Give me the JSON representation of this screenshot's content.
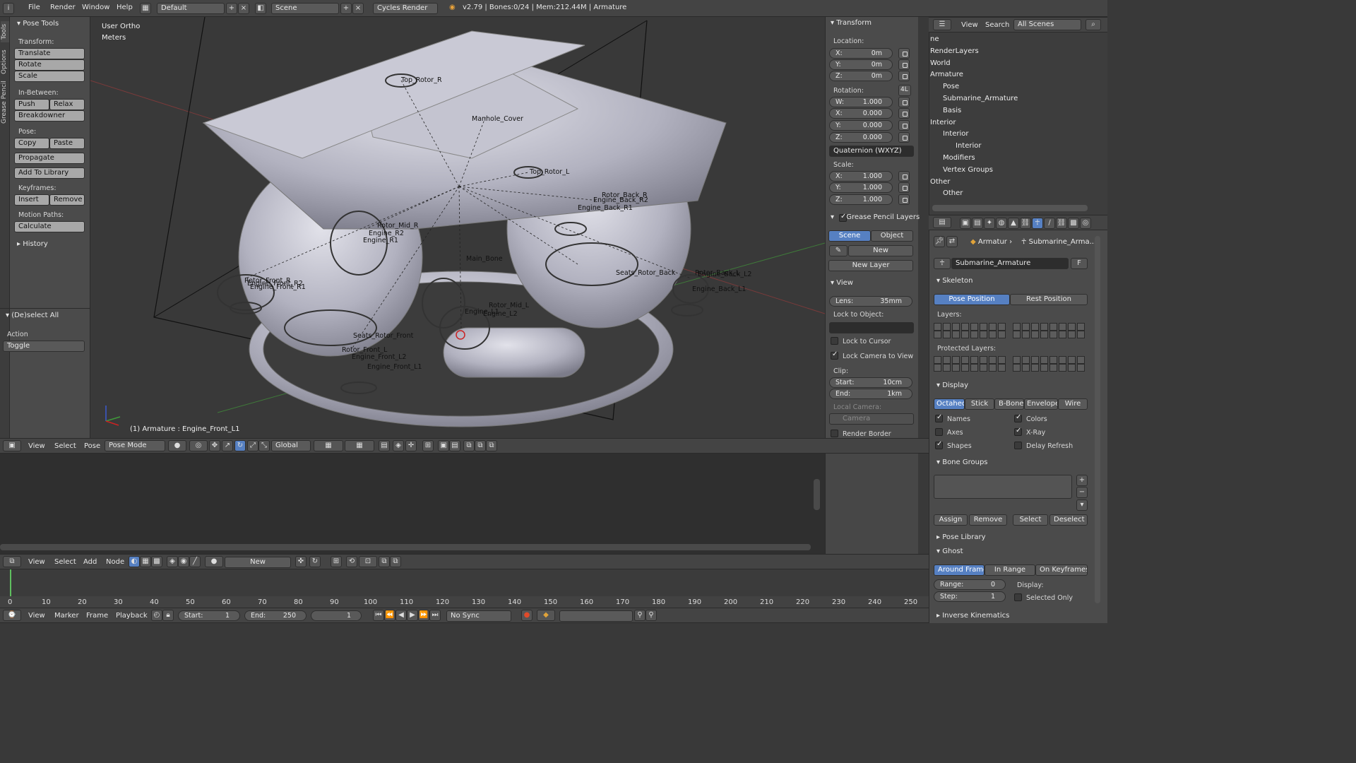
{
  "topbar": {
    "menus": [
      "File",
      "Render",
      "Window",
      "Help"
    ],
    "screen_layout": "Default",
    "scene": "Scene",
    "render_engine": "Cycles Render",
    "stats": "v2.79 | Bones:0/24 | Mem:212.44M | Armature"
  },
  "tool_tabs": [
    "Tools",
    "Options",
    "Grease Pencil"
  ],
  "pose_tools": {
    "title": "Pose Tools",
    "transform_label": "Transform:",
    "translate": "Translate",
    "rotate": "Rotate",
    "scale": "Scale",
    "inbetween_label": "In-Between:",
    "push": "Push",
    "relax": "Relax",
    "breakdowner": "Breakdowner",
    "pose_label": "Pose:",
    "copy": "Copy",
    "paste": "Paste",
    "propagate": "Propagate",
    "add_to_library": "Add To Library",
    "keyframes_label": "Keyframes:",
    "insert": "Insert",
    "remove": "Remove",
    "motion_paths_label": "Motion Paths:",
    "calculate": "Calculate",
    "history": "History"
  },
  "operator": {
    "title": "(De)select All",
    "action_label": "Action",
    "action_value": "Toggle"
  },
  "viewport": {
    "view_name": "User Ortho",
    "units": "Meters",
    "active_info": "(1) Armature : Engine_Front_L1",
    "bone_labels": [
      {
        "id": "top-rotor-r",
        "text": "Top_Rotor_R"
      },
      {
        "id": "manhole-cover",
        "text": "Manhole_Cover"
      },
      {
        "id": "top-rotor-l",
        "text": "Top_Rotor_L"
      },
      {
        "id": "rotor-back-r",
        "text": "Rotor_Back_R"
      },
      {
        "id": "engine-back-r2",
        "text": "Engine_Back_R2"
      },
      {
        "id": "engine-back-r1",
        "text": "Engine_Back_R1"
      },
      {
        "id": "rotor-mid-r",
        "text": "Rotor_Mid_R"
      },
      {
        "id": "engine-r2",
        "text": "Engine_R2"
      },
      {
        "id": "engine-r1",
        "text": "Engine_R1"
      },
      {
        "id": "main-bone",
        "text": "Main_Bone"
      },
      {
        "id": "seats-rotor-back",
        "text": "Seats_Rotor_Back"
      },
      {
        "id": "rotor-back-l",
        "text": "Rotor_Back_L"
      },
      {
        "id": "engine-back-l2",
        "text": "Engine_Back_L2"
      },
      {
        "id": "engine-back-l1",
        "text": "Engine_Back_L1"
      },
      {
        "id": "rotor-front-r",
        "text": "Rotor_Front_R"
      },
      {
        "id": "engine-front-r2",
        "text": "Engine_Front_R2"
      },
      {
        "id": "engine-front-r1",
        "text": "Engine_Front_R1"
      },
      {
        "id": "rotor-mid-l",
        "text": "Rotor_Mid_L"
      },
      {
        "id": "engine-l1",
        "text": "Engine_L1"
      },
      {
        "id": "engine-l2",
        "text": "Engine_L2"
      },
      {
        "id": "seats-rotor-front",
        "text": "Seats_Rotor_Front"
      },
      {
        "id": "rotor-front-l",
        "text": "Rotor_Front_L"
      },
      {
        "id": "engine-front-l2",
        "text": "Engine_Front_L2"
      },
      {
        "id": "engine-front-l1",
        "text": "Engine_Front_L1"
      }
    ]
  },
  "transform_panel": {
    "title": "Transform",
    "location_label": "Location:",
    "loc_x": "X:",
    "loc_x_val": "0m",
    "loc_y": "Y:",
    "loc_y_val": "0m",
    "loc_z": "Z:",
    "loc_z_val": "0m",
    "rotation_label": "Rotation:",
    "rot_4l": "4L",
    "rot_w": "W:",
    "rot_w_val": "1.000",
    "rot_x": "X:",
    "rot_x_val": "0.000",
    "rot_y": "Y:",
    "rot_y_val": "0.000",
    "rot_z": "Z:",
    "rot_z_val": "0.000",
    "rotation_mode": "Quaternion (WXYZ)",
    "scale_label": "Scale:",
    "sc_x": "X:",
    "sc_x_val": "1.000",
    "sc_y": "Y:",
    "sc_y_val": "1.000",
    "sc_z": "Z:",
    "sc_z_val": "1.000"
  },
  "grease_pencil": {
    "title": "Grease Pencil Layers",
    "scene_tab": "Scene",
    "object_tab": "Object",
    "new": "New",
    "new_layer": "New Layer"
  },
  "view_panel": {
    "title": "View",
    "lens_label": "Lens:",
    "lens_val": "35mm",
    "lock_to_object": "Lock to Object:",
    "lock_to_cursor": "Lock to Cursor",
    "lock_camera": "Lock Camera to View",
    "clip_label": "Clip:",
    "start_label": "Start:",
    "start_val": "10cm",
    "end_label": "End:",
    "end_val": "1km",
    "local_camera": "Local Camera:",
    "camera": "Camera",
    "render_border": "Render Border"
  },
  "viewport_header": {
    "view": "View",
    "select": "Select",
    "pose": "Pose",
    "mode": "Pose Mode",
    "orientation": "Global"
  },
  "node_header": {
    "view": "View",
    "select": "Select",
    "add": "Add",
    "node": "Node",
    "new": "New"
  },
  "timeline": {
    "ticks": [
      "0",
      "10",
      "20",
      "30",
      "40",
      "50",
      "60",
      "70",
      "80",
      "90",
      "100",
      "110",
      "120",
      "130",
      "140",
      "150",
      "160",
      "170",
      "180",
      "190",
      "200",
      "210",
      "220",
      "230",
      "240",
      "250"
    ],
    "view": "View",
    "marker": "Marker",
    "frame": "Frame",
    "playback": "Playback",
    "start_label": "Start:",
    "start_val": "1",
    "end_label": "End:",
    "end_val": "250",
    "current": "1",
    "sync": "No Sync"
  },
  "outliner": {
    "view": "View",
    "search": "Search",
    "filter": "All Scenes",
    "items": [
      {
        "text": "ne",
        "indent": 0
      },
      {
        "text": "RenderLayers",
        "indent": 0
      },
      {
        "text": "World",
        "indent": 0
      },
      {
        "text": "Armature",
        "indent": 0
      },
      {
        "text": "Pose",
        "indent": 1
      },
      {
        "text": "Submarine_Armature",
        "indent": 1
      },
      {
        "text": "Basis",
        "indent": 1
      },
      {
        "text": "Interior",
        "indent": 0
      },
      {
        "text": "Interior",
        "indent": 1
      },
      {
        "text": "Interior",
        "indent": 2
      },
      {
        "text": "Modifiers",
        "indent": 1
      },
      {
        "text": "Vertex Groups",
        "indent": 1
      },
      {
        "text": "Other",
        "indent": 0
      },
      {
        "text": "Other",
        "indent": 1
      }
    ]
  },
  "properties": {
    "breadcrumb_1": "Armatur",
    "breadcrumb_2": "Submarine_Arma...",
    "datablock": "Submarine_Armature",
    "fake_user": "F",
    "skeleton": "Skeleton",
    "pose_position": "Pose Position",
    "rest_position": "Rest Position",
    "layers": "Layers:",
    "protected_layers": "Protected Layers:",
    "display": "Display",
    "disp_tabs": [
      "Octahedr",
      "Stick",
      "B-Bone",
      "Envelope",
      "Wire"
    ],
    "names": "Names",
    "colors": "Colors",
    "axes": "Axes",
    "xray": "X-Ray",
    "shapes": "Shapes",
    "delay_refresh": "Delay Refresh",
    "bone_groups": "Bone Groups",
    "assign": "Assign",
    "remove": "Remove",
    "select": "Select",
    "deselect": "Deselect",
    "pose_library": "Pose Library",
    "ghost": "Ghost",
    "ghost_tabs": [
      "Around Frame",
      "In Range",
      "On Keyframes"
    ],
    "range_label": "Range:",
    "range_val": "0",
    "step_label": "Step:",
    "step_val": "1",
    "display_label": "Display:",
    "selected_only": "Selected Only",
    "inverse_kinematics": "Inverse Kinematics"
  },
  "colors": {
    "accent_blue": "#5680c2",
    "panel": "#4b4b4b",
    "viewport_bg": "#393939",
    "mesh": "#b9b9c6"
  }
}
